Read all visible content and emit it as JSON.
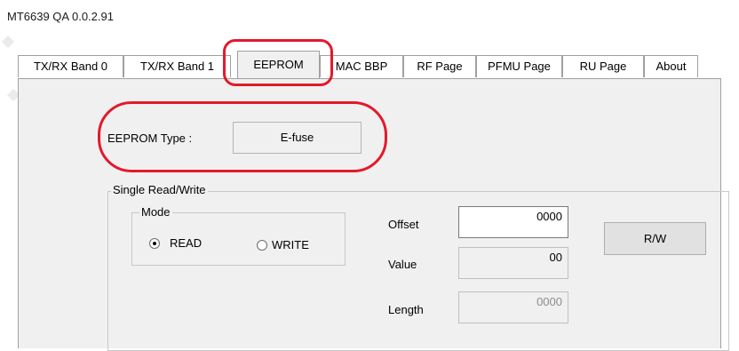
{
  "window": {
    "title": "MT6639 QA 0.0.2.91"
  },
  "tabs": [
    {
      "label": "TX/RX Band 0"
    },
    {
      "label": "TX/RX Band 1"
    },
    {
      "label": "EEPROM"
    },
    {
      "label": "MAC BBP"
    },
    {
      "label": "RF Page"
    },
    {
      "label": "PFMU Page"
    },
    {
      "label": "RU Page"
    },
    {
      "label": "About"
    }
  ],
  "eeprom": {
    "type_label": "EEPROM Type :",
    "type_value": "E-fuse"
  },
  "single_rw": {
    "group_title": "Single Read/Write",
    "mode": {
      "title": "Mode",
      "read_label": "READ",
      "write_label": "WRITE",
      "selected": "READ"
    },
    "offset": {
      "label": "Offset",
      "value": "0000"
    },
    "value": {
      "label": "Value",
      "value": "00"
    },
    "length": {
      "label": "Length",
      "value": "0000"
    },
    "rw_button": "R/W"
  },
  "colors": {
    "highlight": "#e3192c",
    "panel_bg": "#f0f0f0"
  }
}
